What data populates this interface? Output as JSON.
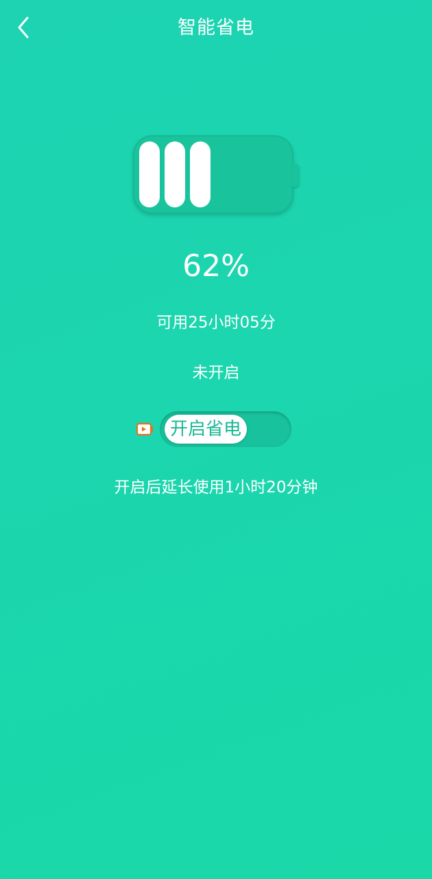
{
  "header": {
    "title": "智能省电",
    "back_icon": "chevron-left-icon"
  },
  "battery": {
    "level_percent": 62,
    "percent_label": "62%",
    "filled_bars": 3,
    "body_color": "#19c49d",
    "bar_color": "#ffffff"
  },
  "remaining_time": "可用25小时05分",
  "status": "未开启",
  "power_saving": {
    "ad_icon": "video-icon",
    "toggle_label": "开启省电",
    "enabled": false
  },
  "extend_info": "开启后延长使用1小时20分钟",
  "colors": {
    "background": "#1bd6ae",
    "accent": "#18b894",
    "icon_orange": "#e8711e"
  }
}
